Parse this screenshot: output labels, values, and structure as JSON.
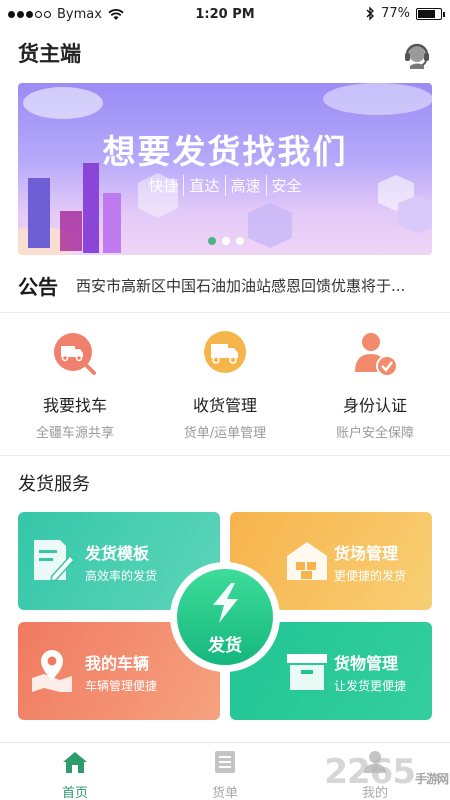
{
  "status_bar": {
    "carrier": "Bymax",
    "time": "1:20 PM",
    "battery": "77%",
    "battery_level": 0.77
  },
  "header": {
    "title": "货主端",
    "support_icon": "customer-service-headset-icon"
  },
  "banner": {
    "headline": "想要发货找我们",
    "tags": [
      "快捷",
      "直达",
      "高速",
      "安全"
    ],
    "page_count": 3,
    "active_page": 1
  },
  "notice": {
    "tag": "公告",
    "text": "西安市高新区中国石油加油站感恩回馈优惠将于..."
  },
  "quick_entries": [
    {
      "title": "我要找车",
      "subtitle": "全疆车源共享",
      "icon": "truck-search-icon",
      "color": "#f0806c"
    },
    {
      "title": "收货管理",
      "subtitle": "货单/运单管理",
      "icon": "delivery-truck-icon",
      "color": "#f5b54a"
    },
    {
      "title": "身份认证",
      "subtitle": "账户安全保障",
      "icon": "user-verified-icon",
      "color": "#f28a6b"
    }
  ],
  "section_title": "发货服务",
  "services": [
    {
      "title": "发货模板",
      "subtitle": "高效率的发货",
      "icon": "template-edit-icon"
    },
    {
      "title": "货场管理",
      "subtitle": "更便捷的发货",
      "icon": "warehouse-icon"
    },
    {
      "title": "我的车辆",
      "subtitle": "车辆管理便捷",
      "icon": "map-pin-icon"
    },
    {
      "title": "货物管理",
      "subtitle": "让发货更便捷",
      "icon": "cargo-box-icon"
    }
  ],
  "ship_button": {
    "label": "发货",
    "icon": "lightning-icon"
  },
  "tabs": [
    {
      "label": "首页",
      "icon": "home-icon",
      "active": true
    },
    {
      "label": "货单",
      "icon": "list-icon",
      "active": false
    },
    {
      "label": "我的",
      "icon": "profile-icon",
      "active": false
    }
  ],
  "watermark": {
    "number": "2265",
    "suffix": "手游网"
  },
  "colors": {
    "brand_green": "#2f9d6b",
    "banner_purple": "#9a8cf5"
  }
}
